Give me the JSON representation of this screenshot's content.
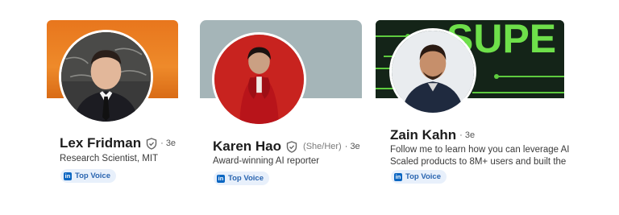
{
  "profiles": [
    {
      "name": "Lex Fridman",
      "verified": true,
      "pronouns": "",
      "degree": "· 3e",
      "headline_lines": [
        "Research Scientist, MIT"
      ],
      "badge": "Top Voice",
      "banner_color": "#e8761d"
    },
    {
      "name": "Karen Hao",
      "verified": true,
      "pronouns": "(She/Her)",
      "degree": "· 3e",
      "headline_lines": [
        "Award-winning AI reporter"
      ],
      "badge": "Top Voice",
      "banner_color": "#a5b5b8"
    },
    {
      "name": "Zain Kahn",
      "verified": false,
      "pronouns": "",
      "degree": "· 3e",
      "headline_lines": [
        "Follow me to learn how you can leverage AI",
        "Scaled products to 8M+ users and built the"
      ],
      "badge": "Top Voice",
      "banner_color": "#142418",
      "banner_text": "SUPE"
    }
  ],
  "icons": {
    "verified": "shield-check-icon",
    "badge": "linkedin-logo-icon"
  }
}
